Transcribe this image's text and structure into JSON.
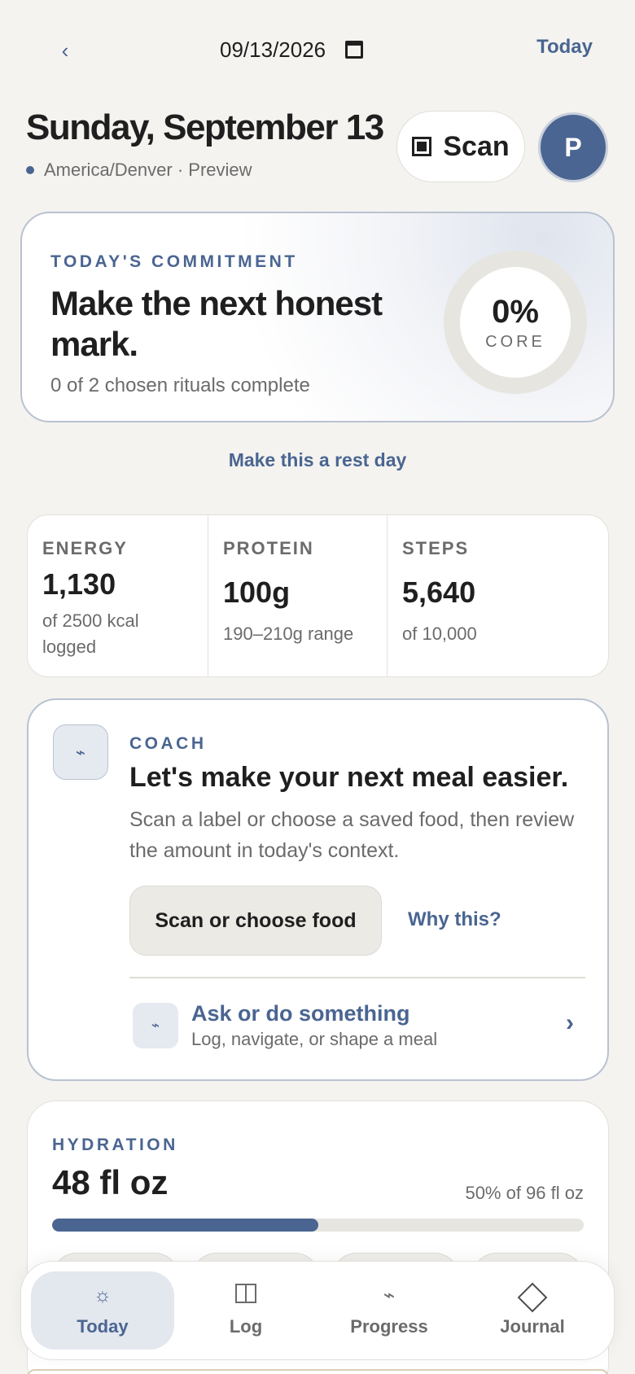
{
  "topbar": {
    "back_label": "‹",
    "date_value": "09/13/2026",
    "today_label": "Today"
  },
  "header": {
    "day_title": "Sunday, September 13",
    "meta": "America/Denver · Preview",
    "scan_label": "Scan",
    "avatar_initial": "P"
  },
  "commitment": {
    "eyebrow": "TODAY'S COMMITMENT",
    "heading": "Make the next honest mark.",
    "subtitle": "0 of 2 chosen rituals complete",
    "ring_value": "0%",
    "ring_label": "CORE",
    "progress_fraction": 0
  },
  "rest_day_label": "Make this a rest day",
  "stats": [
    {
      "label": "ENERGY",
      "value": "1,130",
      "note": "of 2500 kcal logged"
    },
    {
      "label": "PROTEIN",
      "value": "100g",
      "note": "190–210g range"
    },
    {
      "label": "STEPS",
      "value": "5,640",
      "note": "of 10,000"
    }
  ],
  "coach": {
    "icon_glyph": "⌁",
    "eyebrow": "COACH",
    "heading": "Let's make your next meal easier.",
    "body": "Scan a label or choose a saved food, then review the amount in today's context.",
    "primary_button": "Scan or choose food",
    "secondary_link": "Why this?",
    "ask_title": "Ask or do something",
    "ask_subtitle": "Log, navigate, or shape a meal",
    "ask_chevron": "›"
  },
  "hydration": {
    "eyebrow": "HYDRATION",
    "value": "48 fl oz",
    "note": "50% of 96 fl oz",
    "progress_fraction": 0.5
  },
  "nav": {
    "items": [
      {
        "label": "Today",
        "icon": "sun-icon",
        "glyph": "☼"
      },
      {
        "label": "Log",
        "icon": "book-icon",
        "glyph": ""
      },
      {
        "label": "Progress",
        "icon": "bolt-icon",
        "glyph": "⌁"
      },
      {
        "label": "Journal",
        "icon": "diamond-icon",
        "glyph": ""
      }
    ]
  },
  "colors": {
    "accent": "#4a6591",
    "background": "#f4f3f0",
    "muted_text": "#6b6b6b"
  }
}
